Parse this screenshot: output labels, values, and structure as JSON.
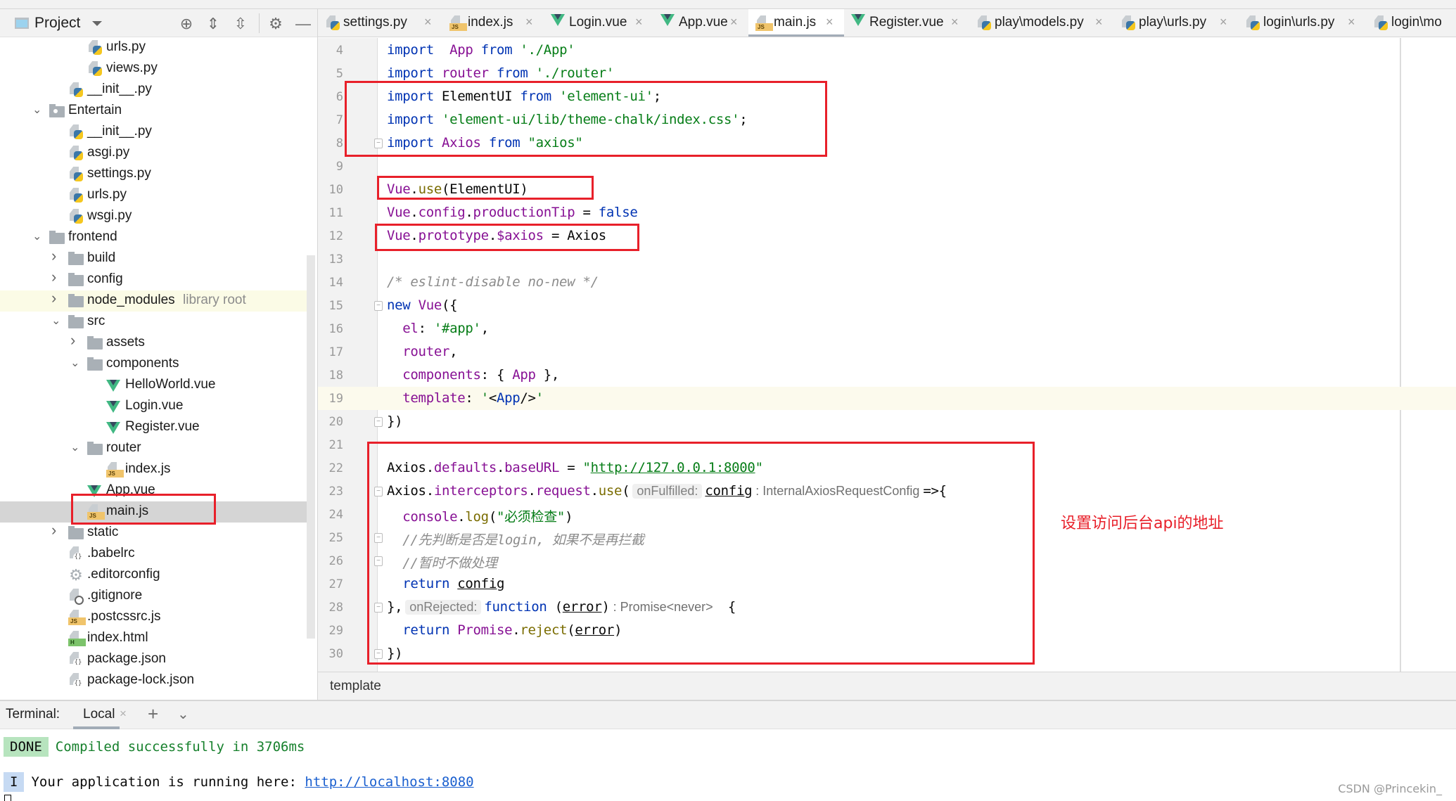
{
  "project_panel": {
    "title": "Project",
    "tools": [
      {
        "name": "locate-icon",
        "glyph": "⊕"
      },
      {
        "name": "expand-all-icon",
        "glyph": "⇕"
      },
      {
        "name": "collapse-all-icon",
        "glyph": "⇳"
      },
      {
        "name": "gear-icon",
        "glyph": "⚙"
      },
      {
        "name": "hide-icon",
        "glyph": "—"
      }
    ],
    "tree": [
      {
        "label": "urls.py",
        "depth": 4,
        "type": "py"
      },
      {
        "label": "views.py",
        "depth": 4,
        "type": "py"
      },
      {
        "label": "__init__.py",
        "depth": 3,
        "type": "py"
      },
      {
        "label": "Entertain",
        "depth": 2,
        "type": "module",
        "expanded": true
      },
      {
        "label": "__init__.py",
        "depth": 3,
        "type": "py"
      },
      {
        "label": "asgi.py",
        "depth": 3,
        "type": "py"
      },
      {
        "label": "settings.py",
        "depth": 3,
        "type": "py"
      },
      {
        "label": "urls.py",
        "depth": 3,
        "type": "py"
      },
      {
        "label": "wsgi.py",
        "depth": 3,
        "type": "py"
      },
      {
        "label": "frontend",
        "depth": 2,
        "type": "folder",
        "expanded": true
      },
      {
        "label": "build",
        "depth": 3,
        "type": "folder",
        "expanded": false
      },
      {
        "label": "config",
        "depth": 3,
        "type": "folder",
        "expanded": false
      },
      {
        "label": "node_modules",
        "depth": 3,
        "type": "folder",
        "expanded": false,
        "hint": "library root",
        "library": true
      },
      {
        "label": "src",
        "depth": 3,
        "type": "folder",
        "expanded": true
      },
      {
        "label": "assets",
        "depth": 4,
        "type": "folder",
        "expanded": false
      },
      {
        "label": "components",
        "depth": 4,
        "type": "folder",
        "expanded": true
      },
      {
        "label": "HelloWorld.vue",
        "depth": 5,
        "type": "vue"
      },
      {
        "label": "Login.vue",
        "depth": 5,
        "type": "vue"
      },
      {
        "label": "Register.vue",
        "depth": 5,
        "type": "vue"
      },
      {
        "label": "router",
        "depth": 4,
        "type": "folder",
        "expanded": true
      },
      {
        "label": "index.js",
        "depth": 5,
        "type": "js"
      },
      {
        "label": "App.vue",
        "depth": 4,
        "type": "vue"
      },
      {
        "label": "main.js",
        "depth": 4,
        "type": "js",
        "selected": true
      },
      {
        "label": "static",
        "depth": 3,
        "type": "folder",
        "expanded": false
      },
      {
        "label": ".babelrc",
        "depth": 3,
        "type": "json"
      },
      {
        "label": ".editorconfig",
        "depth": 3,
        "type": "gear"
      },
      {
        "label": ".gitignore",
        "depth": 3,
        "type": "gitignore"
      },
      {
        "label": ".postcssrc.js",
        "depth": 3,
        "type": "js"
      },
      {
        "label": "index.html",
        "depth": 3,
        "type": "html"
      },
      {
        "label": "package.json",
        "depth": 3,
        "type": "json"
      },
      {
        "label": "package-lock.json",
        "depth": 3,
        "type": "json"
      }
    ]
  },
  "tabs": [
    {
      "label": "settings.py",
      "type": "py",
      "active": false
    },
    {
      "label": "index.js",
      "type": "js",
      "active": false
    },
    {
      "label": "Login.vue",
      "type": "vue",
      "active": false
    },
    {
      "label": "App.vue",
      "type": "vue",
      "active": false
    },
    {
      "label": "main.js",
      "type": "js",
      "active": true
    },
    {
      "label": "Register.vue",
      "type": "vue",
      "active": false
    },
    {
      "label": "play\\models.py",
      "type": "py",
      "active": false
    },
    {
      "label": "play\\urls.py",
      "type": "py",
      "active": false
    },
    {
      "label": "login\\urls.py",
      "type": "py",
      "active": false
    },
    {
      "label": "login\\mo",
      "type": "py",
      "active": false
    }
  ],
  "editor": {
    "current_line": 19,
    "lines": [
      {
        "n": 4,
        "tokens": [
          [
            "kw",
            "import"
          ],
          [
            "",
            "  "
          ],
          [
            "id",
            "App"
          ],
          [
            "",
            " "
          ],
          [
            "kw",
            "from"
          ],
          [
            "",
            " "
          ],
          [
            "str",
            "'./App'"
          ]
        ]
      },
      {
        "n": 5,
        "tokens": [
          [
            "kw",
            "import"
          ],
          [
            "",
            " "
          ],
          [
            "id",
            "router"
          ],
          [
            "",
            " "
          ],
          [
            "kw",
            "from"
          ],
          [
            "",
            " "
          ],
          [
            "str",
            "'./router'"
          ]
        ]
      },
      {
        "n": 6,
        "tokens": [
          [
            "kw",
            "import"
          ],
          [
            "",
            " ElementUI "
          ],
          [
            "kw",
            "from"
          ],
          [
            "",
            " "
          ],
          [
            "str",
            "'element-ui'"
          ],
          [
            "",
            ";"
          ]
        ]
      },
      {
        "n": 7,
        "tokens": [
          [
            "kw",
            "import"
          ],
          [
            "",
            " "
          ],
          [
            "str",
            "'element-ui/lib/theme-chalk/index.css'"
          ],
          [
            "",
            ";"
          ]
        ]
      },
      {
        "n": 8,
        "fold": "end",
        "tokens": [
          [
            "kw",
            "import"
          ],
          [
            "",
            " "
          ],
          [
            "id",
            "Axios"
          ],
          [
            "",
            " "
          ],
          [
            "kw",
            "from"
          ],
          [
            "",
            " "
          ],
          [
            "str",
            "\"axios\""
          ]
        ]
      },
      {
        "n": 9,
        "tokens": []
      },
      {
        "n": 10,
        "tokens": [
          [
            "id",
            "Vue"
          ],
          [
            "",
            "."
          ],
          [
            "fn",
            "use"
          ],
          [
            "",
            "(ElementUI)"
          ]
        ]
      },
      {
        "n": 11,
        "tokens": [
          [
            "id",
            "Vue"
          ],
          [
            "",
            "."
          ],
          [
            "id",
            "config"
          ],
          [
            "",
            "."
          ],
          [
            "id",
            "productionTip"
          ],
          [
            "",
            " = "
          ],
          [
            "kw",
            "false"
          ]
        ]
      },
      {
        "n": 12,
        "tokens": [
          [
            "id",
            "Vue"
          ],
          [
            "",
            "."
          ],
          [
            "id",
            "prototype"
          ],
          [
            "",
            "."
          ],
          [
            "id",
            "$axios"
          ],
          [
            "",
            " = Axios"
          ]
        ]
      },
      {
        "n": 13,
        "tokens": []
      },
      {
        "n": 14,
        "tokens": [
          [
            "cmt",
            "/* eslint-disable no-new */"
          ]
        ]
      },
      {
        "n": 15,
        "fold": "start",
        "tokens": [
          [
            "kw",
            "new"
          ],
          [
            "",
            " "
          ],
          [
            "id",
            "Vue"
          ],
          [
            "",
            "({"
          ]
        ]
      },
      {
        "n": 16,
        "tokens": [
          [
            "",
            "  "
          ],
          [
            "id",
            "el"
          ],
          [
            "",
            ": "
          ],
          [
            "str",
            "'#app'"
          ],
          [
            "",
            ","
          ]
        ]
      },
      {
        "n": 17,
        "tokens": [
          [
            "",
            "  "
          ],
          [
            "id",
            "router"
          ],
          [
            "",
            ","
          ]
        ]
      },
      {
        "n": 18,
        "tokens": [
          [
            "",
            "  "
          ],
          [
            "id",
            "components"
          ],
          [
            "",
            ": { "
          ],
          [
            "id",
            "App"
          ],
          [
            "",
            " },"
          ]
        ]
      },
      {
        "n": 19,
        "tokens": [
          [
            "",
            "  "
          ],
          [
            "id",
            "template"
          ],
          [
            "",
            ": "
          ],
          [
            "str",
            "'"
          ],
          [
            "",
            "<"
          ],
          [
            "kw",
            "App"
          ],
          [
            "",
            "/>"
          ],
          [
            "str",
            "'"
          ]
        ]
      },
      {
        "n": 20,
        "fold": "end",
        "tokens": [
          [
            "",
            "})"
          ]
        ]
      },
      {
        "n": 21,
        "tokens": []
      },
      {
        "n": 22,
        "tokens": [
          [
            "",
            "Axios."
          ],
          [
            "id",
            "defaults"
          ],
          [
            "",
            "."
          ],
          [
            "id",
            "baseURL"
          ],
          [
            "",
            " = "
          ],
          [
            "str",
            "\""
          ],
          [
            "str ul",
            "http://127.0.0.1:8000"
          ],
          [
            "str",
            "\""
          ]
        ]
      },
      {
        "n": 23,
        "fold": "start",
        "tokens": [
          [
            "",
            "Axios."
          ],
          [
            "id",
            "interceptors"
          ],
          [
            "",
            "."
          ],
          [
            "id",
            "request"
          ],
          [
            "",
            "."
          ],
          [
            "fn",
            "use"
          ],
          [
            "",
            "("
          ],
          [
            "pill",
            "onFulfilled:"
          ],
          [
            "ul",
            "config"
          ],
          [
            "type",
            " : InternalAxiosRequestConfig "
          ],
          [
            "",
            "=>{"
          ]
        ]
      },
      {
        "n": 24,
        "tokens": [
          [
            "",
            "  "
          ],
          [
            "id",
            "console"
          ],
          [
            "",
            "."
          ],
          [
            "fn",
            "log"
          ],
          [
            "",
            "("
          ],
          [
            "str",
            "\"必须检查\""
          ],
          [
            "",
            ")"
          ]
        ]
      },
      {
        "n": 25,
        "fold": "start",
        "tokens": [
          [
            "",
            "  "
          ],
          [
            "cmt",
            "//先判断是否是login, 如果不是再拦截"
          ]
        ]
      },
      {
        "n": 26,
        "fold": "end",
        "tokens": [
          [
            "",
            "  "
          ],
          [
            "cmt",
            "//暂时不做处理"
          ]
        ]
      },
      {
        "n": 27,
        "tokens": [
          [
            "",
            "  "
          ],
          [
            "kw",
            "return"
          ],
          [
            "",
            " "
          ],
          [
            "ul",
            "config"
          ]
        ]
      },
      {
        "n": 28,
        "fold": "start",
        "tokens": [
          [
            "",
            "},"
          ],
          [
            "pill",
            "onRejected:"
          ],
          [
            "kw",
            "function"
          ],
          [
            "",
            " ("
          ],
          [
            "ul",
            "error"
          ],
          [
            "",
            ")"
          ],
          [
            "type",
            " : Promise<never>  "
          ],
          [
            "",
            " {"
          ]
        ]
      },
      {
        "n": 29,
        "tokens": [
          [
            "",
            "  "
          ],
          [
            "kw",
            "return"
          ],
          [
            "",
            " "
          ],
          [
            "id",
            "Promise"
          ],
          [
            "",
            "."
          ],
          [
            "fn",
            "reject"
          ],
          [
            "",
            "("
          ],
          [
            "ul",
            "error"
          ],
          [
            "",
            ")"
          ]
        ]
      },
      {
        "n": 30,
        "fold": "end",
        "tokens": [
          [
            "",
            "})"
          ]
        ]
      }
    ],
    "annotation": "设置访问后台api的地址"
  },
  "breadcrumb": "template",
  "terminal": {
    "title": "Terminal:",
    "tab_label": "Local",
    "done_badge": "DONE",
    "done_text": "Compiled successfully in 3706ms",
    "info_badge": "I",
    "info_text": "Your application is running here: ",
    "info_link": "http://localhost:8080"
  },
  "watermark": "CSDN @Princekin_"
}
